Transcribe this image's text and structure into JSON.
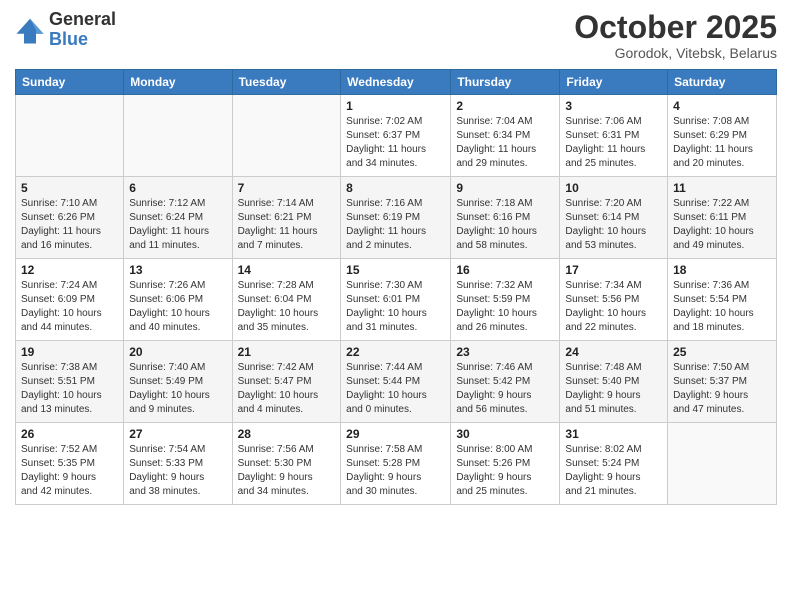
{
  "logo": {
    "general": "General",
    "blue": "Blue"
  },
  "header": {
    "month": "October 2025",
    "location": "Gorodok, Vitebsk, Belarus"
  },
  "weekdays": [
    "Sunday",
    "Monday",
    "Tuesday",
    "Wednesday",
    "Thursday",
    "Friday",
    "Saturday"
  ],
  "weeks": [
    [
      {
        "day": "",
        "info": ""
      },
      {
        "day": "",
        "info": ""
      },
      {
        "day": "",
        "info": ""
      },
      {
        "day": "1",
        "info": "Sunrise: 7:02 AM\nSunset: 6:37 PM\nDaylight: 11 hours\nand 34 minutes."
      },
      {
        "day": "2",
        "info": "Sunrise: 7:04 AM\nSunset: 6:34 PM\nDaylight: 11 hours\nand 29 minutes."
      },
      {
        "day": "3",
        "info": "Sunrise: 7:06 AM\nSunset: 6:31 PM\nDaylight: 11 hours\nand 25 minutes."
      },
      {
        "day": "4",
        "info": "Sunrise: 7:08 AM\nSunset: 6:29 PM\nDaylight: 11 hours\nand 20 minutes."
      }
    ],
    [
      {
        "day": "5",
        "info": "Sunrise: 7:10 AM\nSunset: 6:26 PM\nDaylight: 11 hours\nand 16 minutes."
      },
      {
        "day": "6",
        "info": "Sunrise: 7:12 AM\nSunset: 6:24 PM\nDaylight: 11 hours\nand 11 minutes."
      },
      {
        "day": "7",
        "info": "Sunrise: 7:14 AM\nSunset: 6:21 PM\nDaylight: 11 hours\nand 7 minutes."
      },
      {
        "day": "8",
        "info": "Sunrise: 7:16 AM\nSunset: 6:19 PM\nDaylight: 11 hours\nand 2 minutes."
      },
      {
        "day": "9",
        "info": "Sunrise: 7:18 AM\nSunset: 6:16 PM\nDaylight: 10 hours\nand 58 minutes."
      },
      {
        "day": "10",
        "info": "Sunrise: 7:20 AM\nSunset: 6:14 PM\nDaylight: 10 hours\nand 53 minutes."
      },
      {
        "day": "11",
        "info": "Sunrise: 7:22 AM\nSunset: 6:11 PM\nDaylight: 10 hours\nand 49 minutes."
      }
    ],
    [
      {
        "day": "12",
        "info": "Sunrise: 7:24 AM\nSunset: 6:09 PM\nDaylight: 10 hours\nand 44 minutes."
      },
      {
        "day": "13",
        "info": "Sunrise: 7:26 AM\nSunset: 6:06 PM\nDaylight: 10 hours\nand 40 minutes."
      },
      {
        "day": "14",
        "info": "Sunrise: 7:28 AM\nSunset: 6:04 PM\nDaylight: 10 hours\nand 35 minutes."
      },
      {
        "day": "15",
        "info": "Sunrise: 7:30 AM\nSunset: 6:01 PM\nDaylight: 10 hours\nand 31 minutes."
      },
      {
        "day": "16",
        "info": "Sunrise: 7:32 AM\nSunset: 5:59 PM\nDaylight: 10 hours\nand 26 minutes."
      },
      {
        "day": "17",
        "info": "Sunrise: 7:34 AM\nSunset: 5:56 PM\nDaylight: 10 hours\nand 22 minutes."
      },
      {
        "day": "18",
        "info": "Sunrise: 7:36 AM\nSunset: 5:54 PM\nDaylight: 10 hours\nand 18 minutes."
      }
    ],
    [
      {
        "day": "19",
        "info": "Sunrise: 7:38 AM\nSunset: 5:51 PM\nDaylight: 10 hours\nand 13 minutes."
      },
      {
        "day": "20",
        "info": "Sunrise: 7:40 AM\nSunset: 5:49 PM\nDaylight: 10 hours\nand 9 minutes."
      },
      {
        "day": "21",
        "info": "Sunrise: 7:42 AM\nSunset: 5:47 PM\nDaylight: 10 hours\nand 4 minutes."
      },
      {
        "day": "22",
        "info": "Sunrise: 7:44 AM\nSunset: 5:44 PM\nDaylight: 10 hours\nand 0 minutes."
      },
      {
        "day": "23",
        "info": "Sunrise: 7:46 AM\nSunset: 5:42 PM\nDaylight: 9 hours\nand 56 minutes."
      },
      {
        "day": "24",
        "info": "Sunrise: 7:48 AM\nSunset: 5:40 PM\nDaylight: 9 hours\nand 51 minutes."
      },
      {
        "day": "25",
        "info": "Sunrise: 7:50 AM\nSunset: 5:37 PM\nDaylight: 9 hours\nand 47 minutes."
      }
    ],
    [
      {
        "day": "26",
        "info": "Sunrise: 7:52 AM\nSunset: 5:35 PM\nDaylight: 9 hours\nand 42 minutes."
      },
      {
        "day": "27",
        "info": "Sunrise: 7:54 AM\nSunset: 5:33 PM\nDaylight: 9 hours\nand 38 minutes."
      },
      {
        "day": "28",
        "info": "Sunrise: 7:56 AM\nSunset: 5:30 PM\nDaylight: 9 hours\nand 34 minutes."
      },
      {
        "day": "29",
        "info": "Sunrise: 7:58 AM\nSunset: 5:28 PM\nDaylight: 9 hours\nand 30 minutes."
      },
      {
        "day": "30",
        "info": "Sunrise: 8:00 AM\nSunset: 5:26 PM\nDaylight: 9 hours\nand 25 minutes."
      },
      {
        "day": "31",
        "info": "Sunrise: 8:02 AM\nSunset: 5:24 PM\nDaylight: 9 hours\nand 21 minutes."
      },
      {
        "day": "",
        "info": ""
      }
    ]
  ]
}
